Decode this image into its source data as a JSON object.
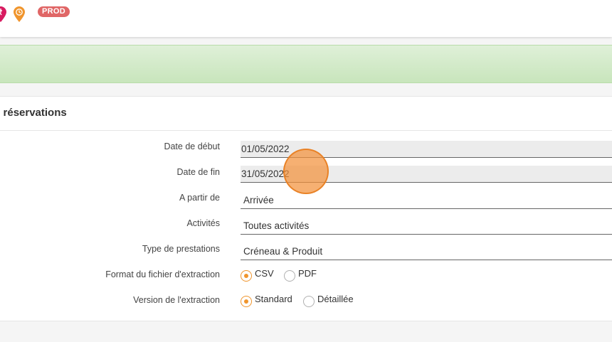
{
  "header": {
    "env_badge": "PROD",
    "icons": [
      "location-pin-magenta-icon",
      "location-pin-clock-orange-icon"
    ],
    "colors": {
      "magenta": "#d81b60",
      "orange": "#f0952d",
      "badge": "#e06666"
    }
  },
  "banner": {
    "color": "#d4ebc9"
  },
  "panel": {
    "title": "s réservations",
    "fields": {
      "date_debut": {
        "label": "Date de début",
        "value": "01/05/2022"
      },
      "date_fin": {
        "label": "Date de fin",
        "value": "31/05/2022"
      },
      "a_partir_de": {
        "label": "A partir de",
        "value": "Arrivée"
      },
      "activites": {
        "label": "Activités",
        "value": "Toutes activités"
      },
      "type_prestations": {
        "label": "Type de prestations",
        "value": "Créneau & Produit"
      },
      "format": {
        "label": "Format du fichier d'extraction",
        "options": [
          "CSV",
          "PDF"
        ],
        "selected": "CSV"
      },
      "version": {
        "label": "Version de l'extraction",
        "options": [
          "Standard",
          "Détaillée"
        ],
        "selected": "Standard"
      }
    }
  }
}
